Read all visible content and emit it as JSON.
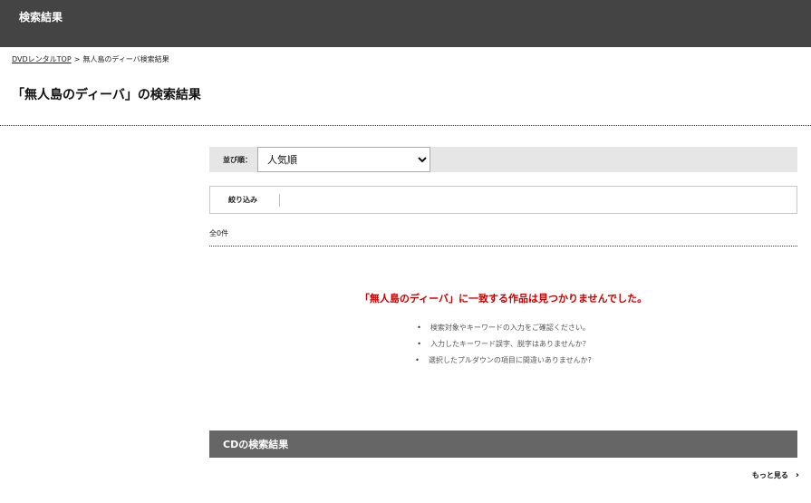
{
  "header": {
    "title": "検索結果"
  },
  "breadcrumb": {
    "home": "DVDレンタルTOP",
    "separator": ">",
    "current": "無人島のディーバ検索結果"
  },
  "page_title": "「無人島のディーバ」の検索結果",
  "sort": {
    "label": "並び順：",
    "selected": "人気順"
  },
  "filter": {
    "label": "絞り込み"
  },
  "result_count": "全0件",
  "no_result": {
    "message": "「無人島のディーバ」に一致する作品は見つかりませんでした。",
    "tips": [
      "検索対象やキーワードの入力をご確認ください。",
      "入力したキーワード誤字、脱字はありませんか？",
      "選択したプルダウンの項目に間違いありませんか?"
    ]
  },
  "cd_section": {
    "title": "CDの検索結果",
    "more_label": "もっと見る"
  },
  "colors": {
    "topbar": "#444444",
    "accent_red": "#cc0000",
    "section_header": "#666666",
    "sortbar": "#e6e6e6"
  }
}
